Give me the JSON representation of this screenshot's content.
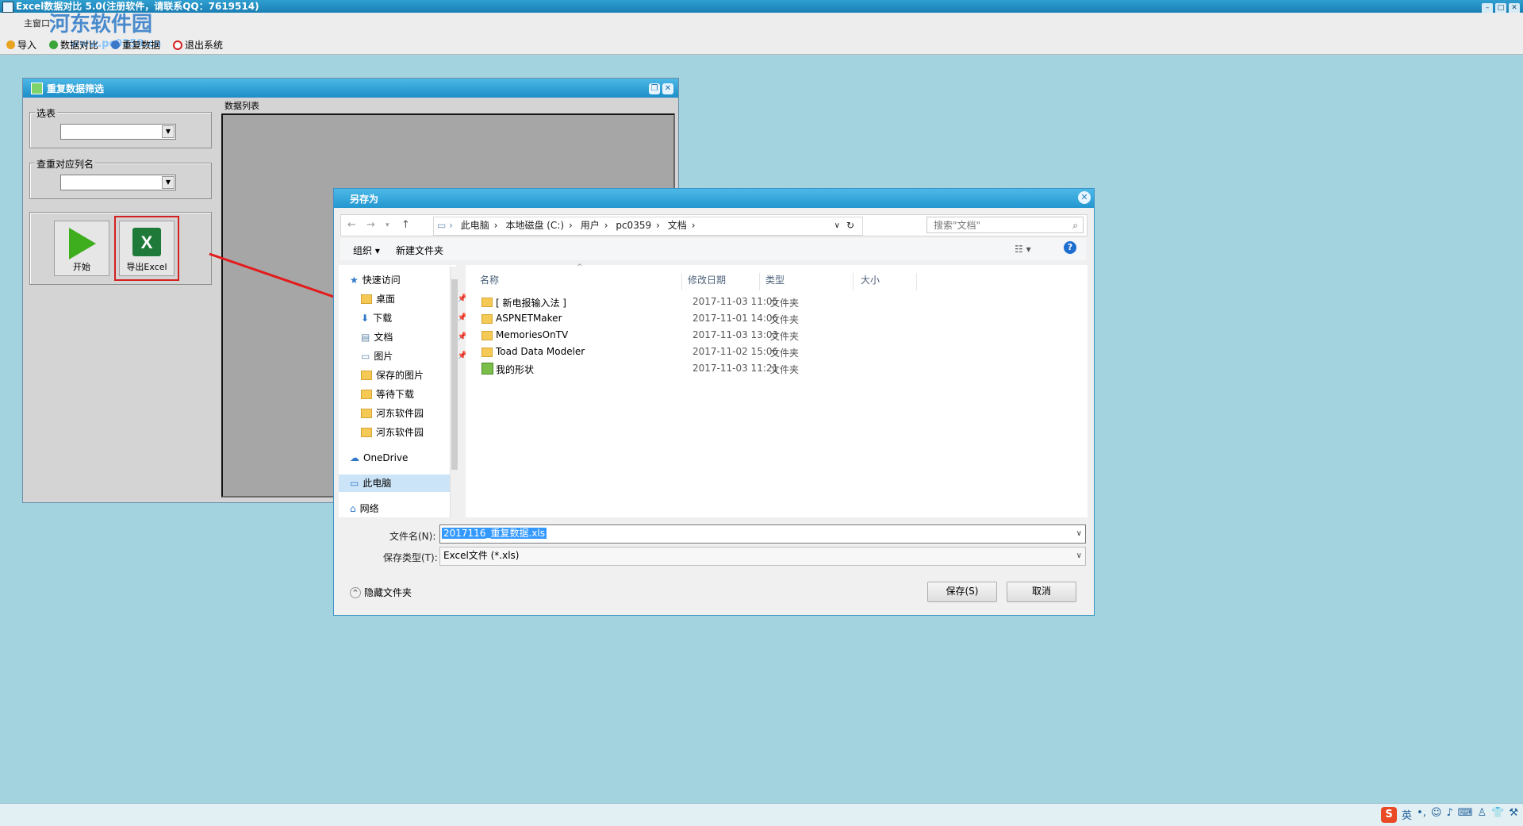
{
  "app": {
    "title": "Excel数据对比  5.0(注册软件，请联系QQ：7619514)",
    "watermark": "河东软件园",
    "watermark_url": "www.pc0359.cn",
    "menu": "主窗口",
    "toolbar": [
      {
        "label": "导入",
        "icon": "import-icon"
      },
      {
        "label": "数据对比",
        "icon": "compare-icon"
      },
      {
        "label": "重复数据",
        "icon": "duplicate-icon"
      },
      {
        "label": "退出系统",
        "icon": "exit-icon"
      }
    ]
  },
  "child_window": {
    "title": "重复数据筛选",
    "group_table": "选表",
    "group_column": "查重对应列名",
    "start_label": "开始",
    "export_label": "导出Excel",
    "data_list_label": "数据列表"
  },
  "dialog": {
    "title": "另存为",
    "breadcrumb": [
      "此电脑",
      "本地磁盘 (C:)",
      "用户",
      "pc0359",
      "文档"
    ],
    "search_placeholder": "搜索\"文档\"",
    "organize": "组织 ▾",
    "new_folder": "新建文件夹",
    "nav": {
      "quick_access": "快速访问",
      "items": [
        "桌面",
        "下载",
        "文档",
        "图片",
        "保存的图片",
        "等待下载",
        "河东软件园",
        "河东软件园"
      ],
      "onedrive": "OneDrive",
      "this_pc": "此电脑",
      "network": "网络"
    },
    "columns": [
      "名称",
      "修改日期",
      "类型",
      "大小"
    ],
    "files": [
      {
        "name": "[ 新电报输入法 ]",
        "date": "2017-11-03 11:05",
        "type": "文件夹"
      },
      {
        "name": "ASPNETMaker",
        "date": "2017-11-01 14:06",
        "type": "文件夹"
      },
      {
        "name": "MemoriesOnTV",
        "date": "2017-11-03 13:03",
        "type": "文件夹"
      },
      {
        "name": "Toad Data Modeler",
        "date": "2017-11-02 15:06",
        "type": "文件夹"
      },
      {
        "name": "我的形状",
        "date": "2017-11-03 11:21",
        "type": "文件夹"
      }
    ],
    "filename_label": "文件名(N):",
    "filename_value": "2017116_重复数据.xls",
    "filetype_label": "保存类型(T):",
    "filetype_value": "Excel文件 (*.xls)",
    "hide_folders": "隐藏文件夹",
    "save": "保存(S)",
    "cancel": "取消"
  },
  "ime": {
    "lang": "英"
  },
  "colors": {
    "accent": "#2396cf",
    "highlight": "#3399ff",
    "arrow": "#e31b1b"
  }
}
